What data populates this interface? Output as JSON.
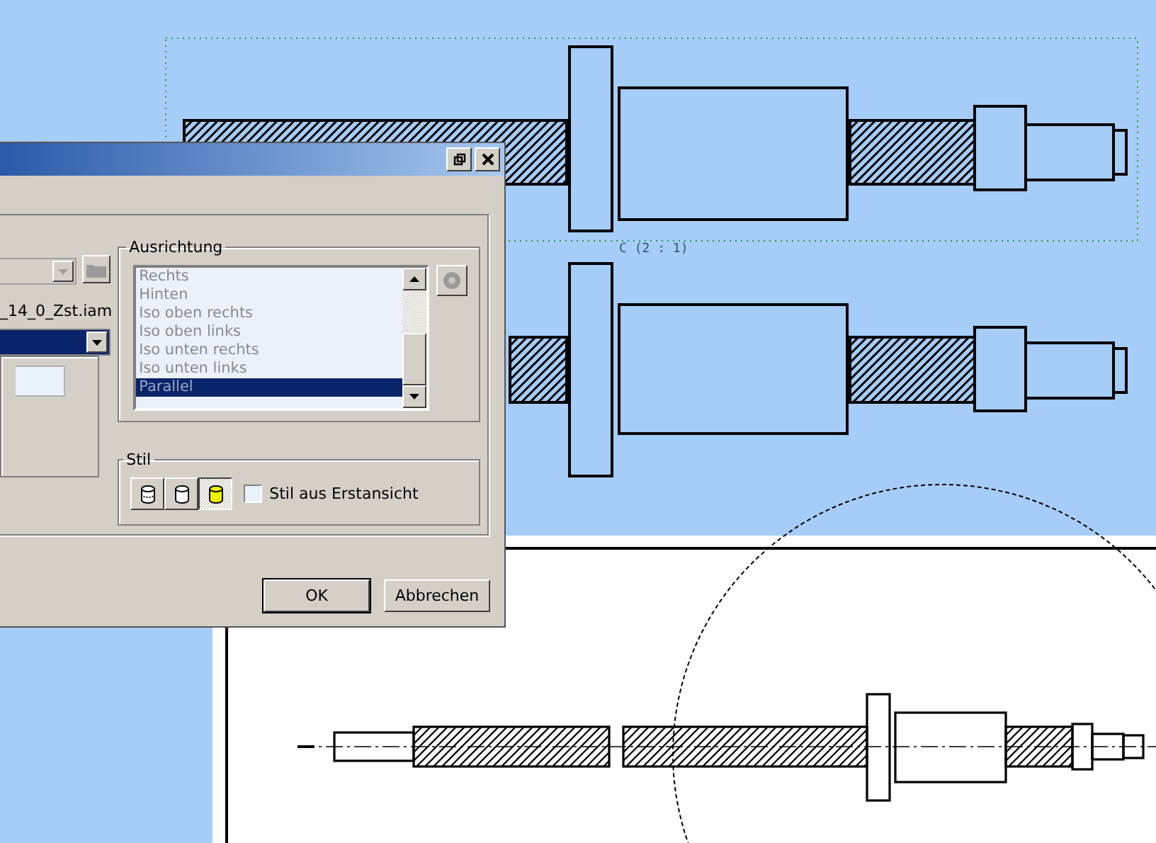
{
  "drawing": {
    "scale_label": "C (2 : 1)"
  },
  "dialog": {
    "file_name": "_14_0_Zst.iam",
    "orientation": {
      "title": "Ausrichtung",
      "items": [
        {
          "label": "Rechts",
          "selected": false
        },
        {
          "label": "Hinten",
          "selected": false
        },
        {
          "label": "Iso oben rechts",
          "selected": false
        },
        {
          "label": "Iso oben links",
          "selected": false
        },
        {
          "label": "Iso unten rechts",
          "selected": false
        },
        {
          "label": "Iso unten links",
          "selected": false
        },
        {
          "label": "Parallel",
          "selected": true
        }
      ]
    },
    "style": {
      "title": "Stil",
      "buttons": [
        {
          "kind": "hidden-lines",
          "selected": false
        },
        {
          "kind": "hidden-lines-removed",
          "selected": false
        },
        {
          "kind": "shaded",
          "selected": true
        }
      ],
      "checkbox": {
        "label": "Stil aus Erstansicht",
        "checked": false
      }
    },
    "buttons": [
      "OK",
      "Abbrechen"
    ]
  }
}
